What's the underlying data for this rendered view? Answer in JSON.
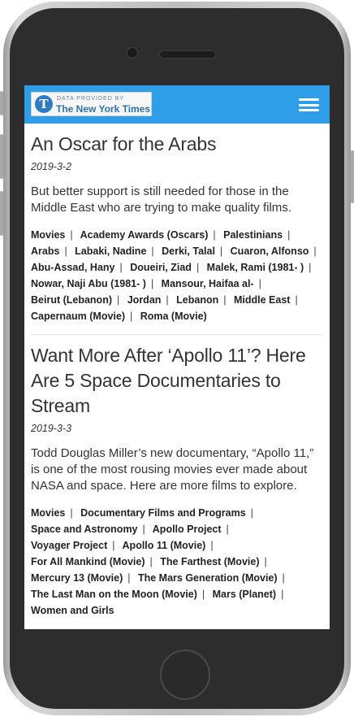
{
  "header": {
    "badge_small": "DATA PROVIDED BY",
    "badge_title": "The New York Times",
    "logo_letter": "T"
  },
  "articles": [
    {
      "title": "An Oscar for the Arabs",
      "date": "2019-3-2",
      "summary": "But better support is still needed for those in the Middle East who are trying to make quality films.",
      "tags": [
        "Movies",
        "Academy Awards (Oscars)",
        "Palestinians",
        "Arabs",
        "Labaki, Nadine",
        "Derki, Talal",
        "Cuaron, Alfonso",
        "Abu-Assad, Hany",
        "Doueiri, Ziad",
        "Malek, Rami (1981- )",
        "Nowar, Naji Abu (1981- )",
        "Mansour, Haifaa al-",
        "Beirut (Lebanon)",
        "Jordan",
        "Lebanon",
        "Middle East",
        "Capernaum (Movie)",
        "Roma (Movie)"
      ]
    },
    {
      "title": "Want More After ‘Apollo 11’? Here Are 5 Space Documentaries to Stream",
      "date": "2019-3-3",
      "summary": "Todd Douglas Miller’s new documentary, “Apollo 11,” is one of the most rousing movies ever made about NASA and space. Here are more films to explore.",
      "tags": [
        "Movies",
        "Documentary Films and Programs",
        "Space and Astronomy",
        "Apollo Project",
        "Voyager Project",
        "Apollo 11 (Movie)",
        "For All Mankind (Movie)",
        "The Farthest (Movie)",
        "Mercury 13 (Movie)",
        "The Mars Generation (Movie)",
        "The Last Man on the Moon (Movie)",
        "Mars (Planet)",
        "Women and Girls"
      ]
    }
  ],
  "colors": {
    "topbar": "#2e9ee9",
    "text": "#333333"
  }
}
